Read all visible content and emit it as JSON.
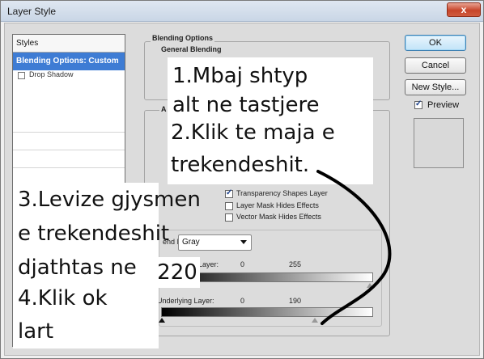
{
  "window": {
    "title": "Layer Style",
    "close_glyph": "x"
  },
  "styles_panel": {
    "header": "Styles",
    "selected_item": "Blending Options: Custom",
    "partial_item": "Drop Shadow"
  },
  "blending": {
    "group_label": "Blending Options",
    "general_label": "General Blending",
    "advanced_label_partial": "A",
    "checkboxes": [
      {
        "label": "Transparency Shapes Layer",
        "checked": true
      },
      {
        "label": "Layer Mask Hides Effects",
        "checked": false
      },
      {
        "label": "Vector Mask Hides Effects",
        "checked": false
      }
    ],
    "blend_if_label": "end If:",
    "blend_if_value": "Gray",
    "this_layer": {
      "label": "Layer:",
      "low": "0",
      "high": "255"
    },
    "underlying_layer": {
      "label": "Underlying Layer:",
      "low": "0",
      "high": "190"
    }
  },
  "annotations": {
    "box1_line1": "1.Mbaj shtyp",
    "box1_line2": "alt ne tastjere",
    "box1_line3": "2.Klik te maja e",
    "box1_line4": "trekendeshit.",
    "box2_line1": "3.Levize gjysmen",
    "box2_line2": "e trekendeshit",
    "box2_line3": "djathtas ne",
    "box2_line4": "4.Klik ok",
    "box2_line5": "lart",
    "value_box": "220"
  },
  "buttons": {
    "ok": "OK",
    "cancel": "Cancel",
    "new_style": "New Style...",
    "preview_label": "Preview",
    "preview_checked": true
  }
}
